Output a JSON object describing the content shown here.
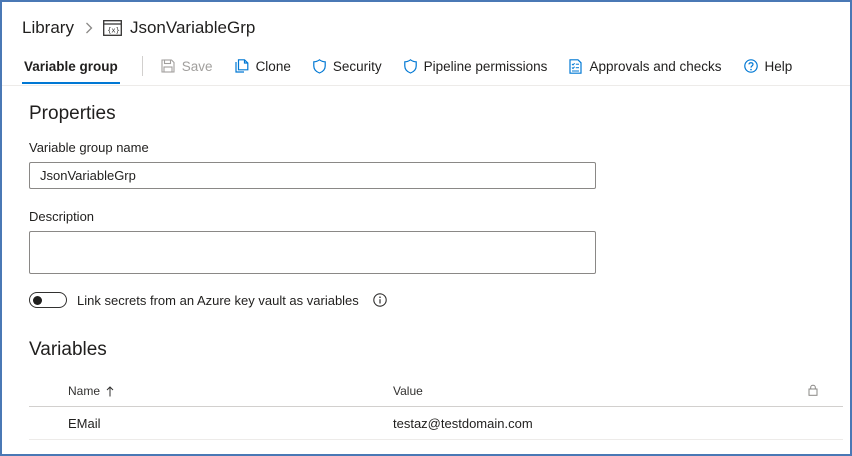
{
  "breadcrumb": {
    "root": "Library",
    "current": "JsonVariableGrp",
    "current_icon": "variable-group-icon"
  },
  "toolbar": {
    "active_tab": "Variable group",
    "save": "Save",
    "clone": "Clone",
    "security": "Security",
    "pipeline_permissions": "Pipeline permissions",
    "approvals": "Approvals and checks",
    "help": "Help"
  },
  "properties": {
    "title": "Properties",
    "name_label": "Variable group name",
    "name_value": "JsonVariableGrp",
    "description_label": "Description",
    "description_value": "",
    "link_secrets_label": "Link secrets from an Azure key vault as variables",
    "link_secrets_on": false
  },
  "variables": {
    "title": "Variables",
    "columns": {
      "name": "Name",
      "value": "Value"
    },
    "sort": "ascending",
    "rows": [
      {
        "name": "EMail",
        "value": "testaz@testdomain.com"
      }
    ]
  },
  "colors": {
    "accent": "#0078d4",
    "frame_border": "#4a78b5"
  }
}
